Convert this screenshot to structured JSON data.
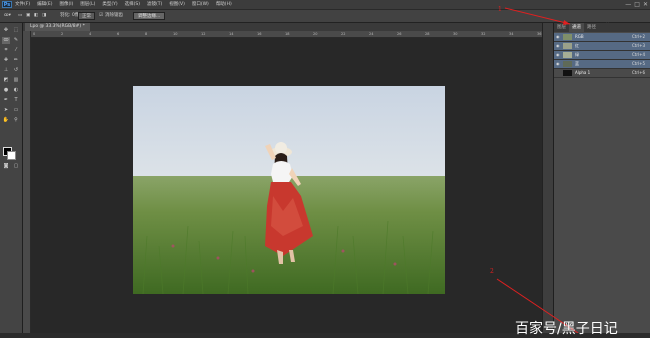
{
  "app": {
    "logo": "Ps"
  },
  "menu": {
    "items": [
      "文件(F)",
      "编辑(E)",
      "图像(I)",
      "图层(L)",
      "类型(Y)",
      "选择(S)",
      "滤镜(T)",
      "视图(V)",
      "窗口(W)",
      "帮助(H)"
    ]
  },
  "window_controls": [
    "—",
    "□",
    "✕"
  ],
  "options_bar": {
    "tolerance_label": "羽化: 0像素",
    "style_select": "正常",
    "anti_alias_label": "消除锯齿",
    "refine_edge_button": "调整边缘...",
    "workspace": "基本功能"
  },
  "document": {
    "tab_label": "Lpo @ 33.3%(RGB/8#) *"
  },
  "ruler": {
    "ticks": [
      "0",
      "2",
      "4",
      "6",
      "8",
      "10",
      "12",
      "14",
      "16",
      "18",
      "20",
      "22",
      "24",
      "26",
      "28",
      "30",
      "32",
      "34",
      "36"
    ]
  },
  "panel": {
    "tabs": [
      "图层",
      "通道",
      "路径"
    ],
    "channels": [
      {
        "name": "RGB",
        "key": "Ctrl+2",
        "thumb": "#7f8f6a"
      },
      {
        "name": "红",
        "key": "Ctrl+3",
        "thumb": "#9aa08a"
      },
      {
        "name": "绿",
        "key": "Ctrl+4",
        "thumb": "#a5ad95"
      },
      {
        "name": "蓝",
        "key": "Ctrl+5",
        "thumb": "#5f6a58"
      },
      {
        "name": "Alpha 1",
        "key": "Ctrl+6",
        "thumb": "#111111"
      }
    ]
  },
  "annotations": {
    "one": "1",
    "two": "2"
  },
  "watermark": "百家号/黑子日记",
  "colors": {
    "accent_red": "#e02020",
    "selected_row": "#566a84"
  }
}
